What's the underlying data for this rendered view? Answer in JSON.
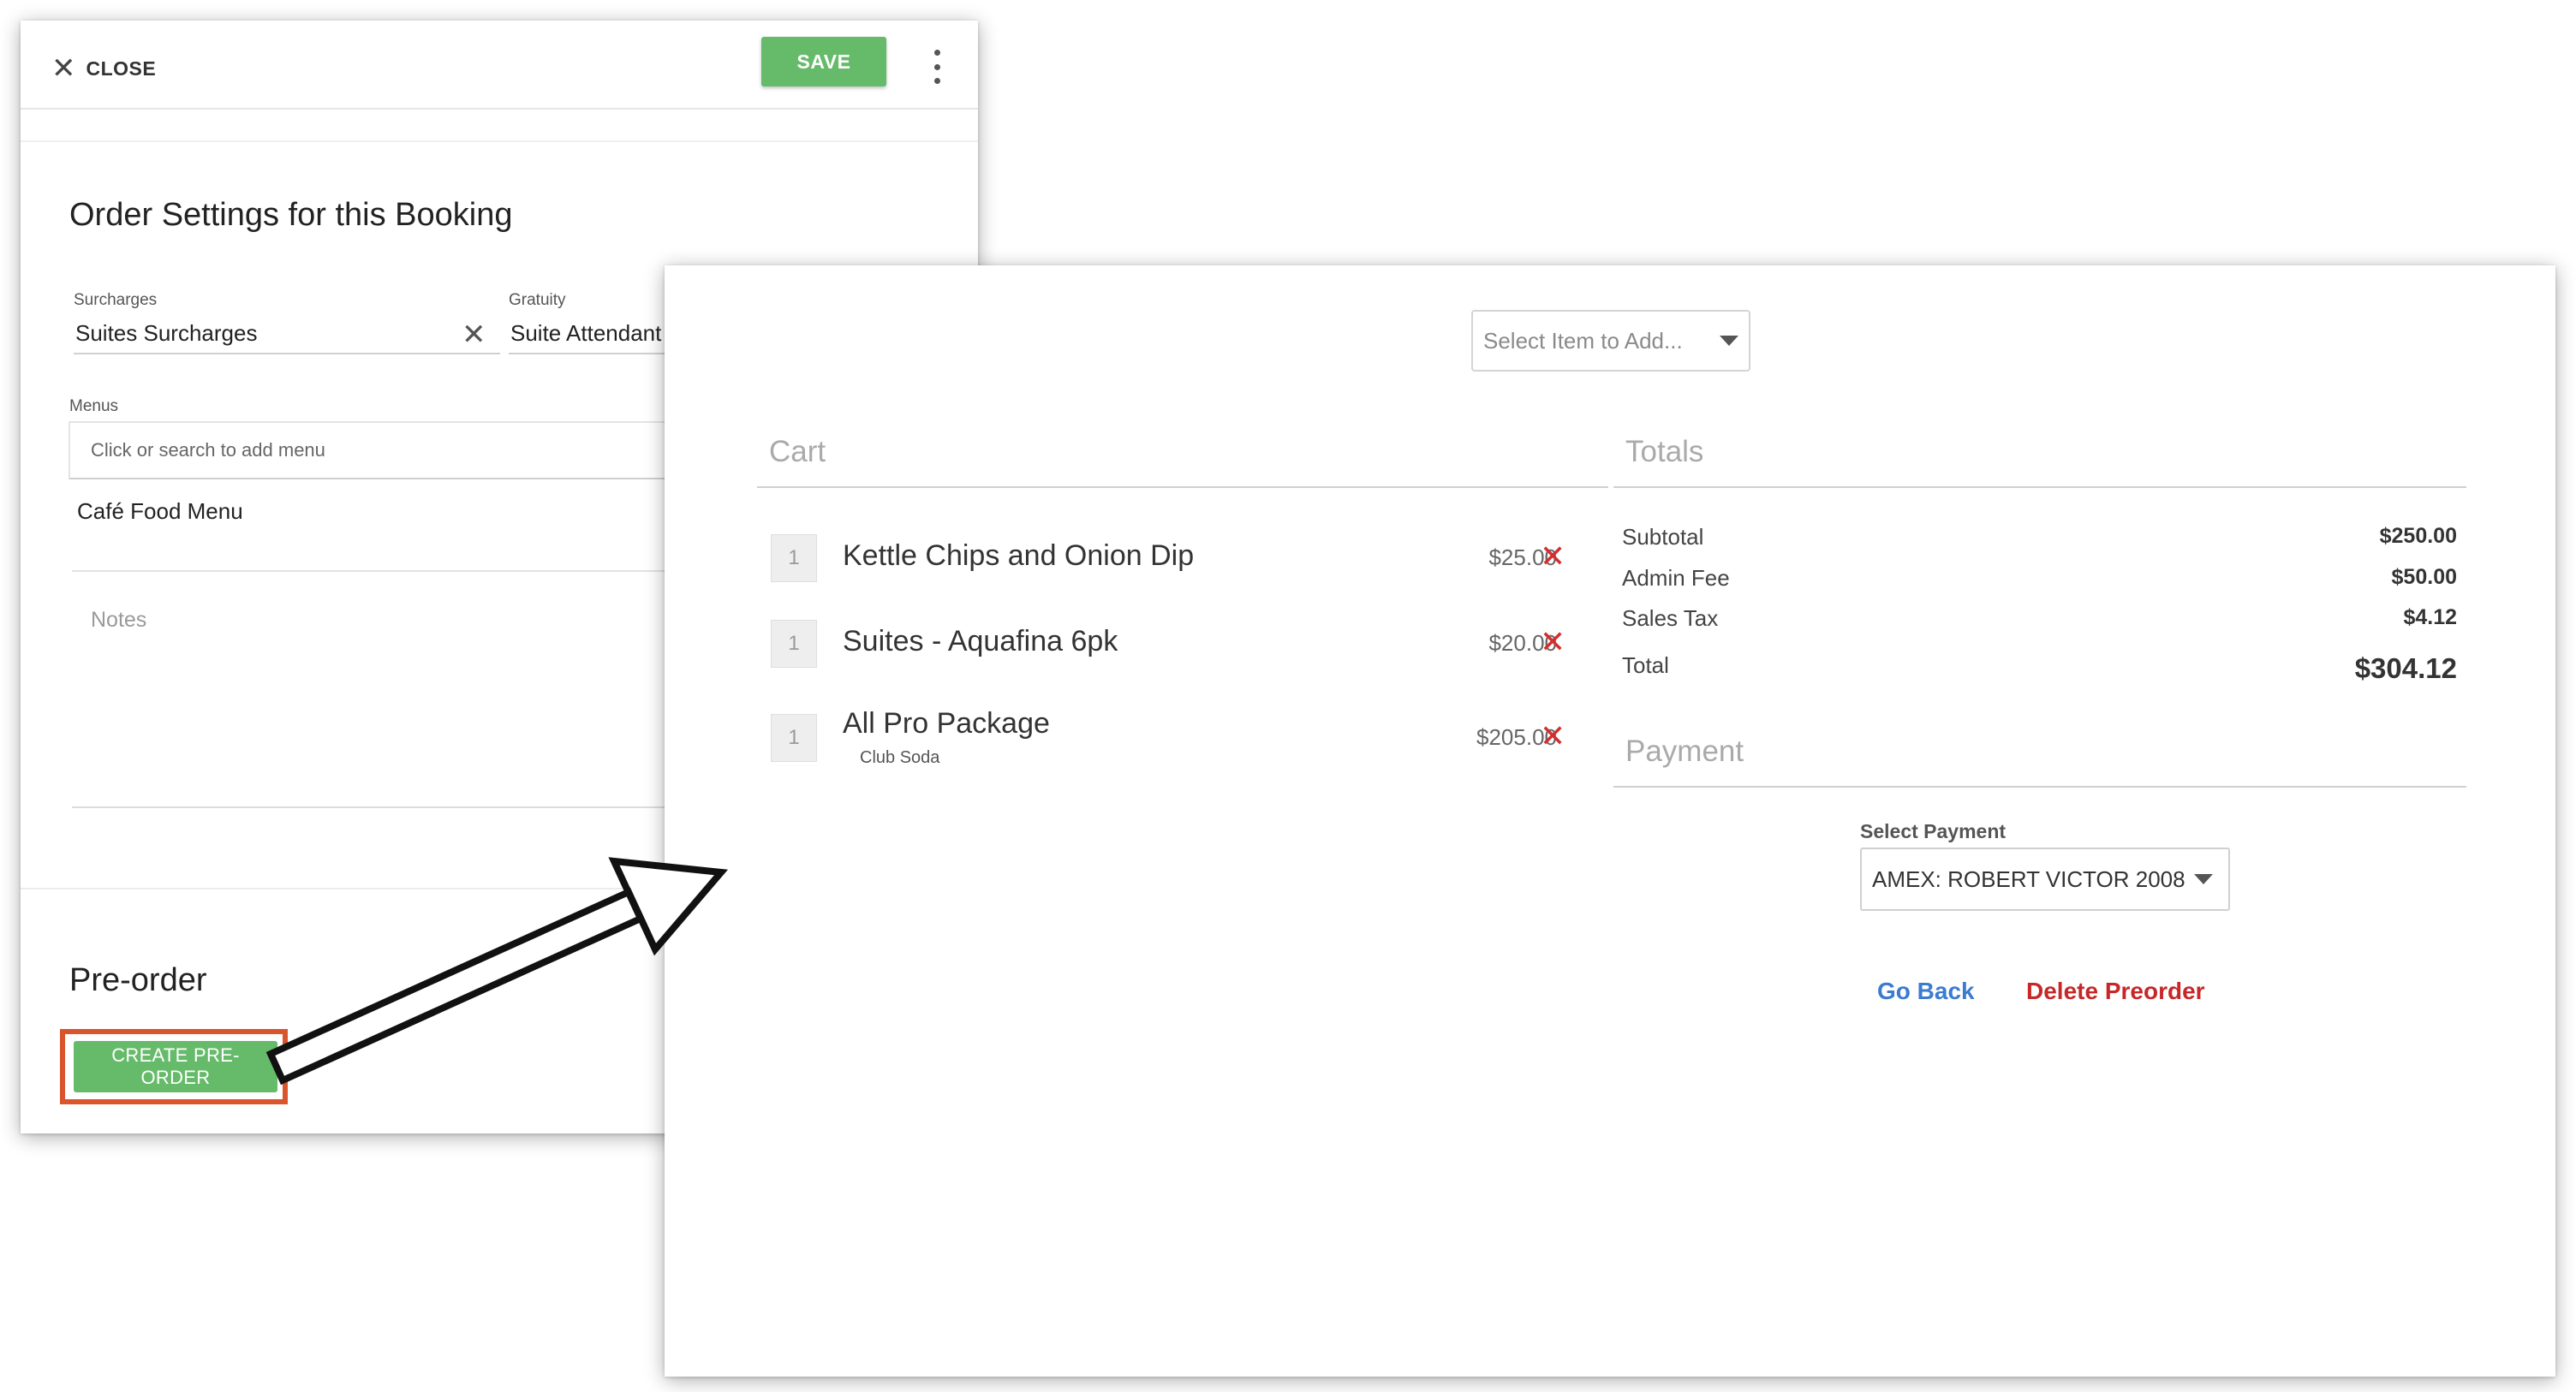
{
  "order_settings": {
    "close_label": "CLOSE",
    "save_label": "SAVE",
    "title": "Order Settings for this Booking",
    "surcharges": {
      "label": "Surcharges",
      "value": "Suites Surcharges"
    },
    "gratuity": {
      "label": "Gratuity",
      "value": "Suite Attendant"
    },
    "menus": {
      "label": "Menus",
      "placeholder": "Click or search to add menu",
      "selected": "Café Food Menu"
    },
    "notes_placeholder": "Notes",
    "preorder": {
      "title": "Pre-order",
      "button_label": "CREATE PRE-ORDER"
    }
  },
  "cart_panel": {
    "select_item_placeholder": "Select Item to Add...",
    "cart_heading": "Cart",
    "totals_heading": "Totals",
    "payment_heading": "Payment",
    "items": [
      {
        "qty": "1",
        "name": "Kettle Chips and Onion Dip",
        "sub": "",
        "price": "$25.00"
      },
      {
        "qty": "1",
        "name": "Suites - Aquafina 6pk",
        "sub": "",
        "price": "$20.00"
      },
      {
        "qty": "1",
        "name": "All Pro Package",
        "sub": "Club Soda",
        "price": "$205.00"
      }
    ],
    "totals": [
      {
        "label": "Subtotal",
        "value": "$250.00"
      },
      {
        "label": "Admin Fee",
        "value": "$50.00"
      },
      {
        "label": "Sales Tax",
        "value": "$4.12"
      },
      {
        "label": "Total",
        "value": "$304.12"
      }
    ],
    "select_payment_label": "Select Payment",
    "payment_value": "AMEX: ROBERT VICTOR 2008",
    "go_back_label": "Go Back",
    "delete_label": "Delete Preorder"
  },
  "colors": {
    "accent_green": "#66bb6a",
    "highlight_orange": "#d9552c",
    "link_blue": "#3b7bd0",
    "delete_red": "#c62828",
    "remove_red": "#d32f2f"
  },
  "icons": [
    "close-icon",
    "more-vert-icon",
    "clear-icon",
    "dropdown-caret-icon",
    "remove-item-icon",
    "arrow-icon"
  ]
}
